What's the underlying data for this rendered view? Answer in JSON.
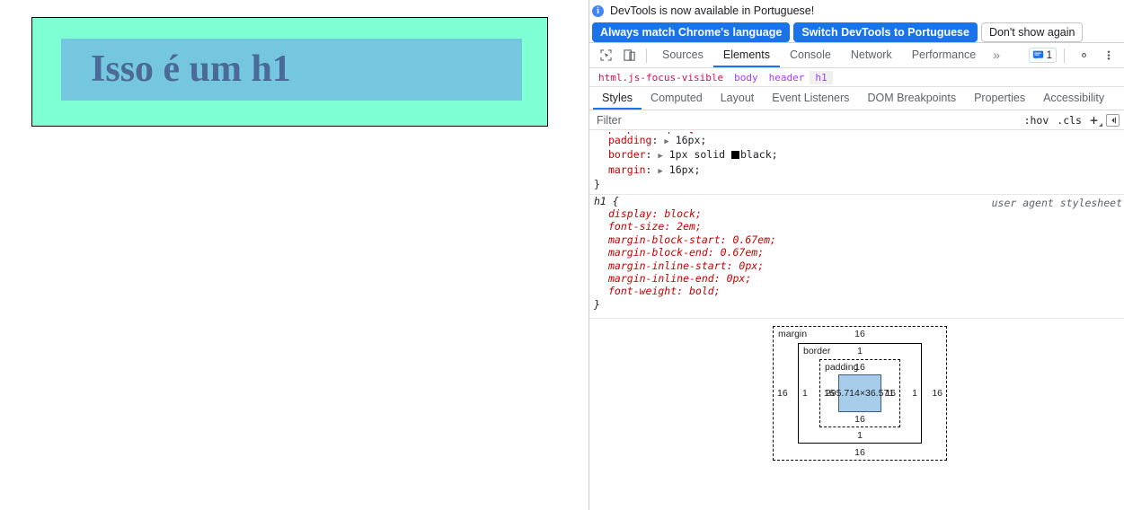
{
  "page": {
    "heading": "Isso é um h1",
    "header_bg": "#7FFFD4",
    "heading_bg": "#74C7DF",
    "heading_color": "#4B6A97",
    "border_color": "#000000"
  },
  "devtools": {
    "infobar": {
      "icon": "info-icon",
      "message": "DevTools is now available in Portuguese!",
      "buttons": [
        {
          "label": "Always match Chrome's language",
          "style": "primary"
        },
        {
          "label": "Switch DevTools to Portuguese",
          "style": "primary"
        },
        {
          "label": "Don't show again",
          "style": "secondary"
        }
      ]
    },
    "toolbar": {
      "inspect_icon": "inspect-element-icon",
      "device_icon": "device-toolbar-icon",
      "tabs": [
        {
          "label": "Sources",
          "active": false
        },
        {
          "label": "Elements",
          "active": true
        },
        {
          "label": "Console",
          "active": false
        },
        {
          "label": "Network",
          "active": false
        },
        {
          "label": "Performance",
          "active": false
        }
      ],
      "more_tabs_label": "»",
      "issues_icon": "issues-message-icon",
      "issues_count": "1",
      "settings_icon": "gear-icon",
      "menu_icon": "kebab-menu-icon"
    },
    "breadcrumb": [
      {
        "label": "html.js-focus-visible",
        "selected": false,
        "root": true
      },
      {
        "label": "body",
        "selected": false,
        "root": false
      },
      {
        "label": "header",
        "selected": false,
        "root": false
      },
      {
        "label": "h1",
        "selected": true,
        "root": false
      }
    ],
    "sidebar_tabs": [
      {
        "label": "Styles",
        "active": true
      },
      {
        "label": "Computed",
        "active": false
      },
      {
        "label": "Layout",
        "active": false
      },
      {
        "label": "Event Listeners",
        "active": false
      },
      {
        "label": "DOM Breakpoints",
        "active": false
      },
      {
        "label": "Properties",
        "active": false
      },
      {
        "label": "Accessibility",
        "active": false
      }
    ],
    "filter": {
      "placeholder": "Filter",
      "value": "",
      "hov_label": ":hov",
      "cls_label": ".cls",
      "new_rule_label": "+",
      "sidebar_toggle_icon": "toggle-sidebar-icon"
    },
    "styles_rules": [
      {
        "origin": "",
        "selector": "",
        "clipped_top": true,
        "declarations": [
          {
            "property": "padding",
            "value": "16px",
            "expandable": true,
            "swatch": null
          },
          {
            "property": "border",
            "value": "1px solid black",
            "expandable": true,
            "swatch": "#000000"
          },
          {
            "property": "margin",
            "value": "16px",
            "expandable": true,
            "swatch": null
          }
        ],
        "close": "}"
      },
      {
        "origin": "user agent stylesheet",
        "selector": "h1 {",
        "clipped_top": false,
        "ua": true,
        "declarations": [
          {
            "property": "display",
            "value": "block",
            "expandable": false,
            "swatch": null
          },
          {
            "property": "font-size",
            "value": "2em",
            "expandable": false,
            "swatch": null
          },
          {
            "property": "margin-block-start",
            "value": "0.67em",
            "expandable": false,
            "swatch": null
          },
          {
            "property": "margin-block-end",
            "value": "0.67em",
            "expandable": false,
            "swatch": null
          },
          {
            "property": "margin-inline-start",
            "value": "0px",
            "expandable": false,
            "swatch": null
          },
          {
            "property": "margin-inline-end",
            "value": "0px",
            "expandable": false,
            "swatch": null
          },
          {
            "property": "font-weight",
            "value": "bold",
            "expandable": false,
            "swatch": null
          }
        ],
        "close": "}"
      }
    ],
    "box_model": {
      "margin_label": "margin",
      "border_label": "border",
      "padding_label": "padding",
      "content_size": "295.714×36.571",
      "margin": {
        "top": "16",
        "right": "16",
        "bottom": "16",
        "left": "16"
      },
      "border": {
        "top": "1",
        "right": "1",
        "bottom": "1",
        "left": "1"
      },
      "padding": {
        "top": "16",
        "right": "16",
        "bottom": "16",
        "left": "16"
      },
      "content_fill": "#a8cdea"
    }
  }
}
